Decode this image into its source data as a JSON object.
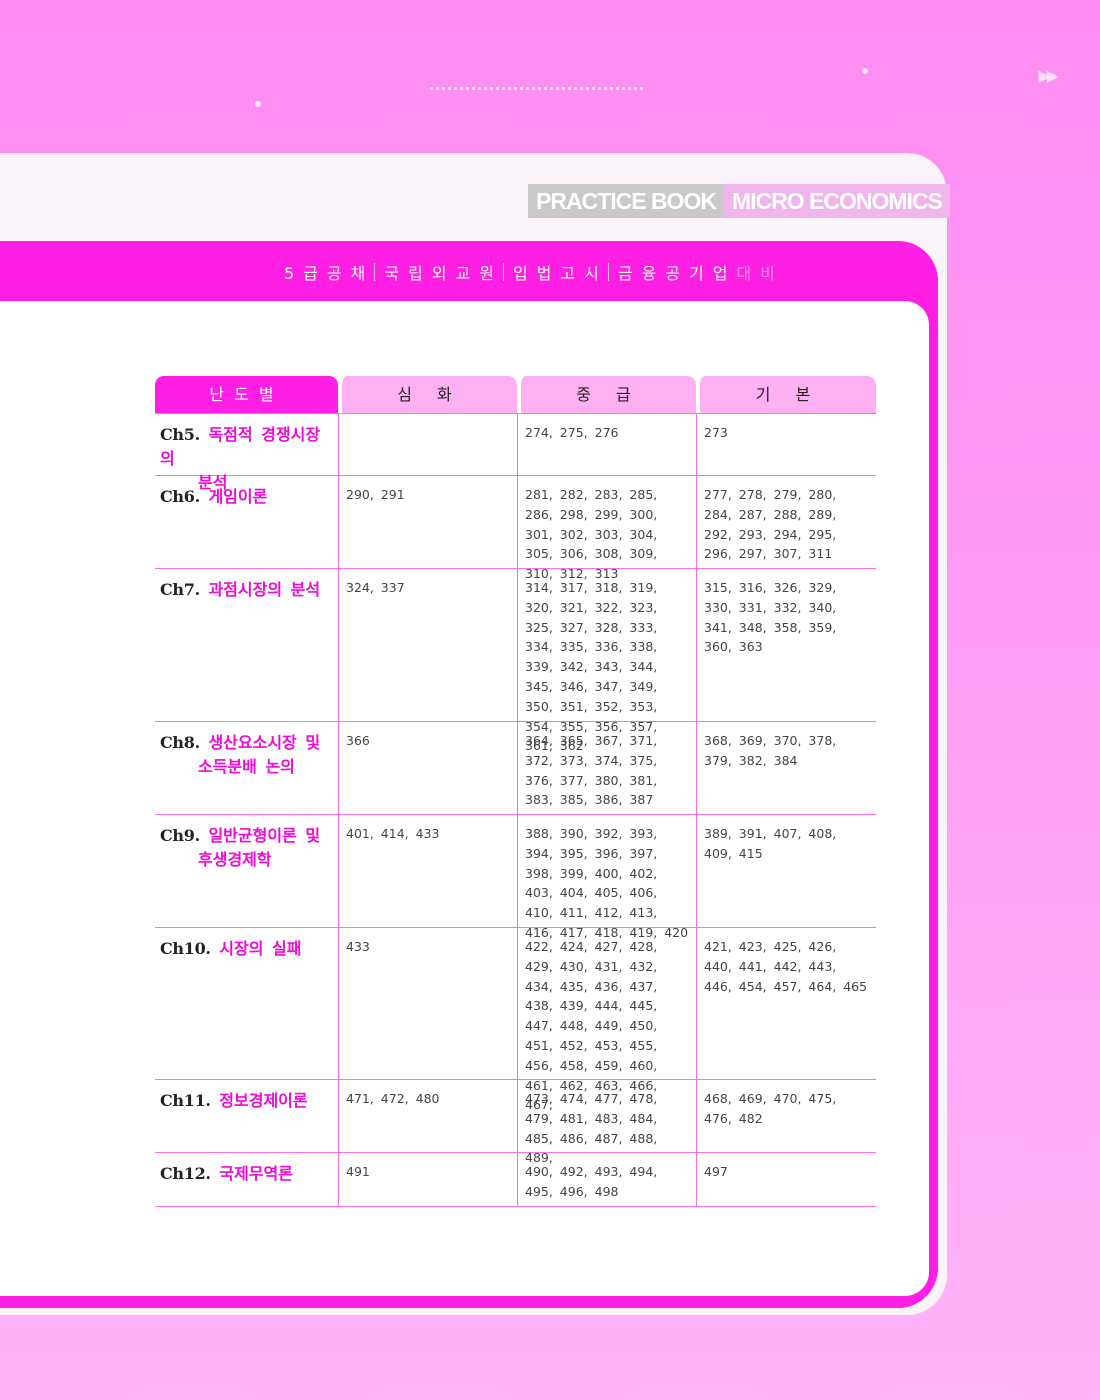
{
  "header": {
    "brand_left": "PRACTICE BOOK",
    "brand_right": "MICRO ECONOMICS",
    "subtitle_items": [
      "5급공채",
      "국립외교원",
      "입법고시",
      "금융공기업"
    ],
    "subtitle_tail": "대비"
  },
  "table": {
    "headers": [
      "난도별",
      "심 화",
      "중 급",
      "기 본"
    ],
    "rows": [
      {
        "chapter": "Ch5.",
        "title1": "독점적 경쟁시장의",
        "title2": "분석",
        "advanced": "",
        "intermediate": "274, 275, 276",
        "basic": "273"
      },
      {
        "chapter": "Ch6.",
        "title1": "게임이론",
        "title2": "",
        "advanced": "290, 291",
        "intermediate": "281, 282, 283, 285, 286, 298, 299, 300, 301, 302, 303, 304, 305, 306, 308, 309, 310, 312, 313",
        "basic": "277, 278, 279, 280, 284, 287, 288, 289, 292, 293, 294, 295, 296, 297, 307, 311"
      },
      {
        "chapter": "Ch7.",
        "title1": "과점시장의 분석",
        "title2": "",
        "advanced": "324, 337",
        "intermediate": "314, 317, 318, 319, 320, 321, 322, 323, 325, 327, 328, 333, 334, 335, 336, 338, 339, 342, 343, 344, 345, 346, 347, 349, 350, 351, 352, 353, 354, 355, 356, 357, 361, 362",
        "basic": "315, 316, 326, 329, 330, 331, 332, 340, 341, 348, 358, 359, 360, 363"
      },
      {
        "chapter": "Ch8.",
        "title1": "생산요소시장 및",
        "title2": "소득분배 논의",
        "advanced": "366",
        "intermediate": "364, 365, 367, 371, 372, 373, 374, 375, 376, 377, 380, 381, 383, 385, 386, 387",
        "basic": "368, 369, 370, 378, 379, 382, 384"
      },
      {
        "chapter": "Ch9.",
        "title1": "일반균형이론 및",
        "title2": "후생경제학",
        "advanced": "401, 414, 433",
        "intermediate": "388, 390, 392, 393, 394, 395, 396, 397, 398, 399, 400, 402, 403, 404, 405, 406, 410, 411, 412, 413, 416, 417, 418, 419, 420",
        "basic": "389, 391, 407, 408, 409, 415"
      },
      {
        "chapter": "Ch10.",
        "title1": "시장의 실패",
        "title2": "",
        "advanced": "433",
        "intermediate": "422, 424, 427, 428, 429, 430, 431, 432, 434, 435, 436, 437, 438, 439, 444, 445, 447, 448, 449, 450, 451, 452, 453, 455, 456, 458, 459, 460, 461, 462, 463, 466, 467,",
        "basic": "421, 423, 425, 426, 440, 441, 442, 443, 446, 454, 457, 464, 465"
      },
      {
        "chapter": "Ch11.",
        "title1": "정보경제이론",
        "title2": "",
        "advanced": "471, 472, 480",
        "intermediate": "473, 474, 477, 478, 479, 481, 483, 484, 485, 486, 487, 488, 489,",
        "basic": "468, 469, 470, 475, 476, 482"
      },
      {
        "chapter": "Ch12.",
        "title1": "국제무역론",
        "title2": "",
        "advanced": "491",
        "intermediate": "490, 492, 493, 494, 495, 496, 498",
        "basic": "497"
      }
    ]
  },
  "colors": {
    "accent": "#ff1ee3",
    "chapter_title": "#f10ad6",
    "header_tab": "#ffb0f2"
  }
}
